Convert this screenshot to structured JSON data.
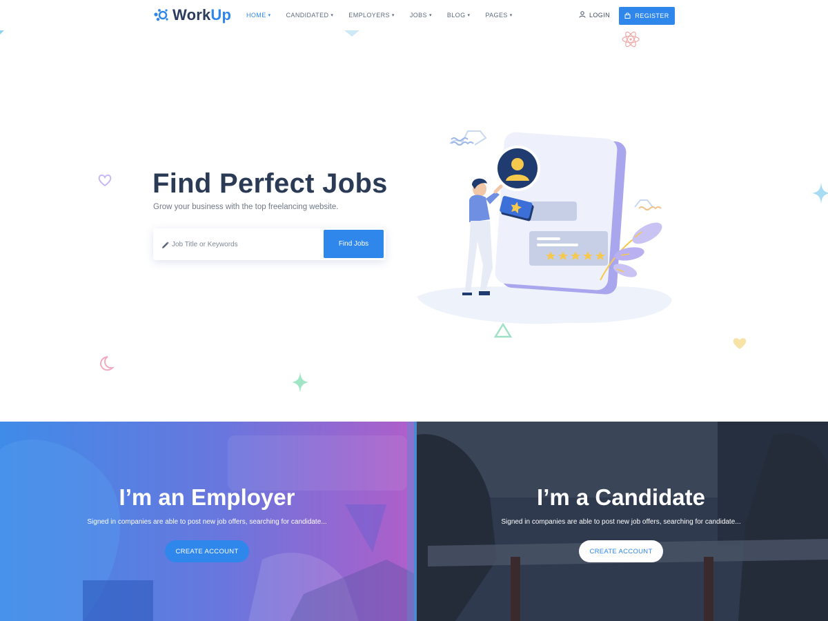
{
  "brand": {
    "name_part1": "Work",
    "name_part2": "Up"
  },
  "nav": {
    "items": [
      {
        "label": "HOME",
        "active": true
      },
      {
        "label": "CANDIDATED",
        "active": false
      },
      {
        "label": "EMPLOYERS",
        "active": false
      },
      {
        "label": "JOBS",
        "active": false
      },
      {
        "label": "BLOG",
        "active": false
      },
      {
        "label": "PAGES",
        "active": false
      }
    ],
    "login_label": "LOGIN",
    "register_label": "REGISTER"
  },
  "hero": {
    "title": "Find Perfect Jobs",
    "subtitle": "Grow your business with the top freelancing website.",
    "search_placeholder": "Job Title or Keywords",
    "search_value": "",
    "search_button": "Find Jobs"
  },
  "cards": [
    {
      "title": "I’m an Employer",
      "description": "Signed in companies are able to post new job offers, searching for candidate...",
      "button": "CREATE ACCOUNT"
    },
    {
      "title": "I’m a Candidate",
      "description": "Signed in companies are able to post new job offers, searching for candidate...",
      "button": "CREATE ACCOUNT"
    }
  ],
  "colors": {
    "accent": "#2f86eb",
    "heading": "#2b3a55",
    "employer_overlay_start": "#3f8be8",
    "employer_overlay_end": "#b05ec9",
    "candidate_overlay": "#2f3a4e"
  }
}
